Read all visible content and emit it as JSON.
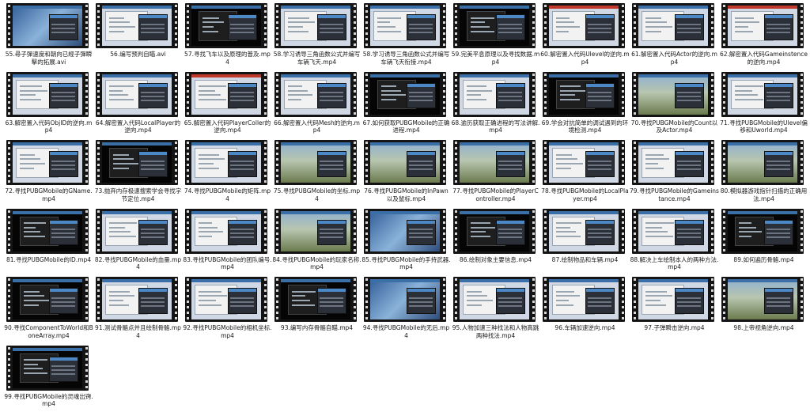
{
  "view": "thumbnail-grid",
  "files": [
    {
      "name": "55.尋子彈速度和朝向已經子彈瞬擊的拓展.avi",
      "style": "photo"
    },
    {
      "name": "56.编写预判自瞄.avi",
      "style": "ui"
    },
    {
      "name": "57.寻找飞车以及原理的普及.mp4",
      "style": "black"
    },
    {
      "name": "58.学习诱导三角函数公式并编写车辆飞天.mp4",
      "style": "ui"
    },
    {
      "name": "58.学习诱导三角函数公式并编写车辆飞天衔接.mp4",
      "style": "ui"
    },
    {
      "name": "59.完美平息原理以及寻找数据.mp4",
      "style": "black"
    },
    {
      "name": "60.解密置入代码Ulevel的逆向.mp4",
      "style": "red"
    },
    {
      "name": "61.解密置入代码Actor的逆向.mp4",
      "style": "ui"
    },
    {
      "name": "62.解密置入代码Gameinstence的逆向.mp4",
      "style": "red"
    },
    {
      "name": "63.解密置入代码ObjID的逆向.mp4",
      "style": "ui"
    },
    {
      "name": "64.解密置入代码LocalPlayer的逆向.mp4",
      "style": "ui"
    },
    {
      "name": "65.解密置入代码PlayerColler的逆向.mp4",
      "style": "red"
    },
    {
      "name": "66.解密置入代码Mesh的逆向.mp4",
      "style": "ui"
    },
    {
      "name": "67.如何获取PUBGMobile的正确进程.mp4",
      "style": "black"
    },
    {
      "name": "68.逾历获取正确进程的写法讲解.mp4",
      "style": "ui"
    },
    {
      "name": "69.学会对抗简单的调试遇到的环境检测.mp4",
      "style": "black"
    },
    {
      "name": "70.寻找PUBGMobile的Count以及Actor.mp4",
      "style": "game"
    },
    {
      "name": "71.寻找PUBGMobile的Ulevel偏移和Uworld.mp4",
      "style": "ui"
    },
    {
      "name": "72.寻找PUBGMobile的GName.mp4",
      "style": "ui"
    },
    {
      "name": "73.抛弃内存极速搜索学会寻找字节定位.mp4",
      "style": "black"
    },
    {
      "name": "74.寻找PUBGMobile的矩阵.mp4",
      "style": "ui"
    },
    {
      "name": "75.寻找PUBGMobile的坐标.mp4",
      "style": "game"
    },
    {
      "name": "76.寻找PUBGMobile的InPawn以及鼠标.mp4",
      "style": "game"
    },
    {
      "name": "77.寻找PUBGMobile的PlayerController.mp4",
      "style": "game"
    },
    {
      "name": "78.寻找PUBGMobile的LocalPlayer.mp4",
      "style": "ui"
    },
    {
      "name": "79.寻找PUBGMobile的Gameinstance.mp4",
      "style": "ui"
    },
    {
      "name": "80.模拟器游戏指针扫描的正确用法.mp4",
      "style": "game"
    },
    {
      "name": "81.寻找PUBGMobile的ID.mp4",
      "style": "black"
    },
    {
      "name": "82.寻找PUBGMobile的血量.mp4",
      "style": "ui"
    },
    {
      "name": "83.寻找PUBGMobile的团队编号.mp4",
      "style": "ui"
    },
    {
      "name": "84.寻找PUBGMobile的玩家名称.mp4",
      "style": "game"
    },
    {
      "name": "85.寻找PUBGMobile的手持武器.mp4",
      "style": "photo"
    },
    {
      "name": "86.绘制对象主要信息.mp4",
      "style": "black"
    },
    {
      "name": "87.绘制物品和车辆.mp4",
      "style": "ui"
    },
    {
      "name": "88.解决上车绘制本人的两种方法.mp4",
      "style": "ui"
    },
    {
      "name": "89.如何遍历骨骼.mp4",
      "style": "black"
    },
    {
      "name": "90.寻找ComponentToWorld和BoneArray.mp4",
      "style": "black"
    },
    {
      "name": "91.测试骨骼点并且绘制骨骼.mp4",
      "style": "ui"
    },
    {
      "name": "92.寻找PUBGMobile的相机坐标.mp4",
      "style": "ui"
    },
    {
      "name": "93.编写内存骨骼自瞄.mp4",
      "style": "black"
    },
    {
      "name": "94.寻找PUBGMobile的无后.mp4",
      "style": "photo"
    },
    {
      "name": "95.人物加速三种找法和人物高跳两种找法.mp4",
      "style": "ui"
    },
    {
      "name": "96.车辆加速逆向.mp4",
      "style": "ui"
    },
    {
      "name": "97.子弹瞬击逆向.mp4",
      "style": "ui"
    },
    {
      "name": "98.上帝视角逆向.mp4",
      "style": "game"
    },
    {
      "name": "99.寻找PUBGMobile的灵魂出窍.mp4",
      "style": "black"
    }
  ]
}
